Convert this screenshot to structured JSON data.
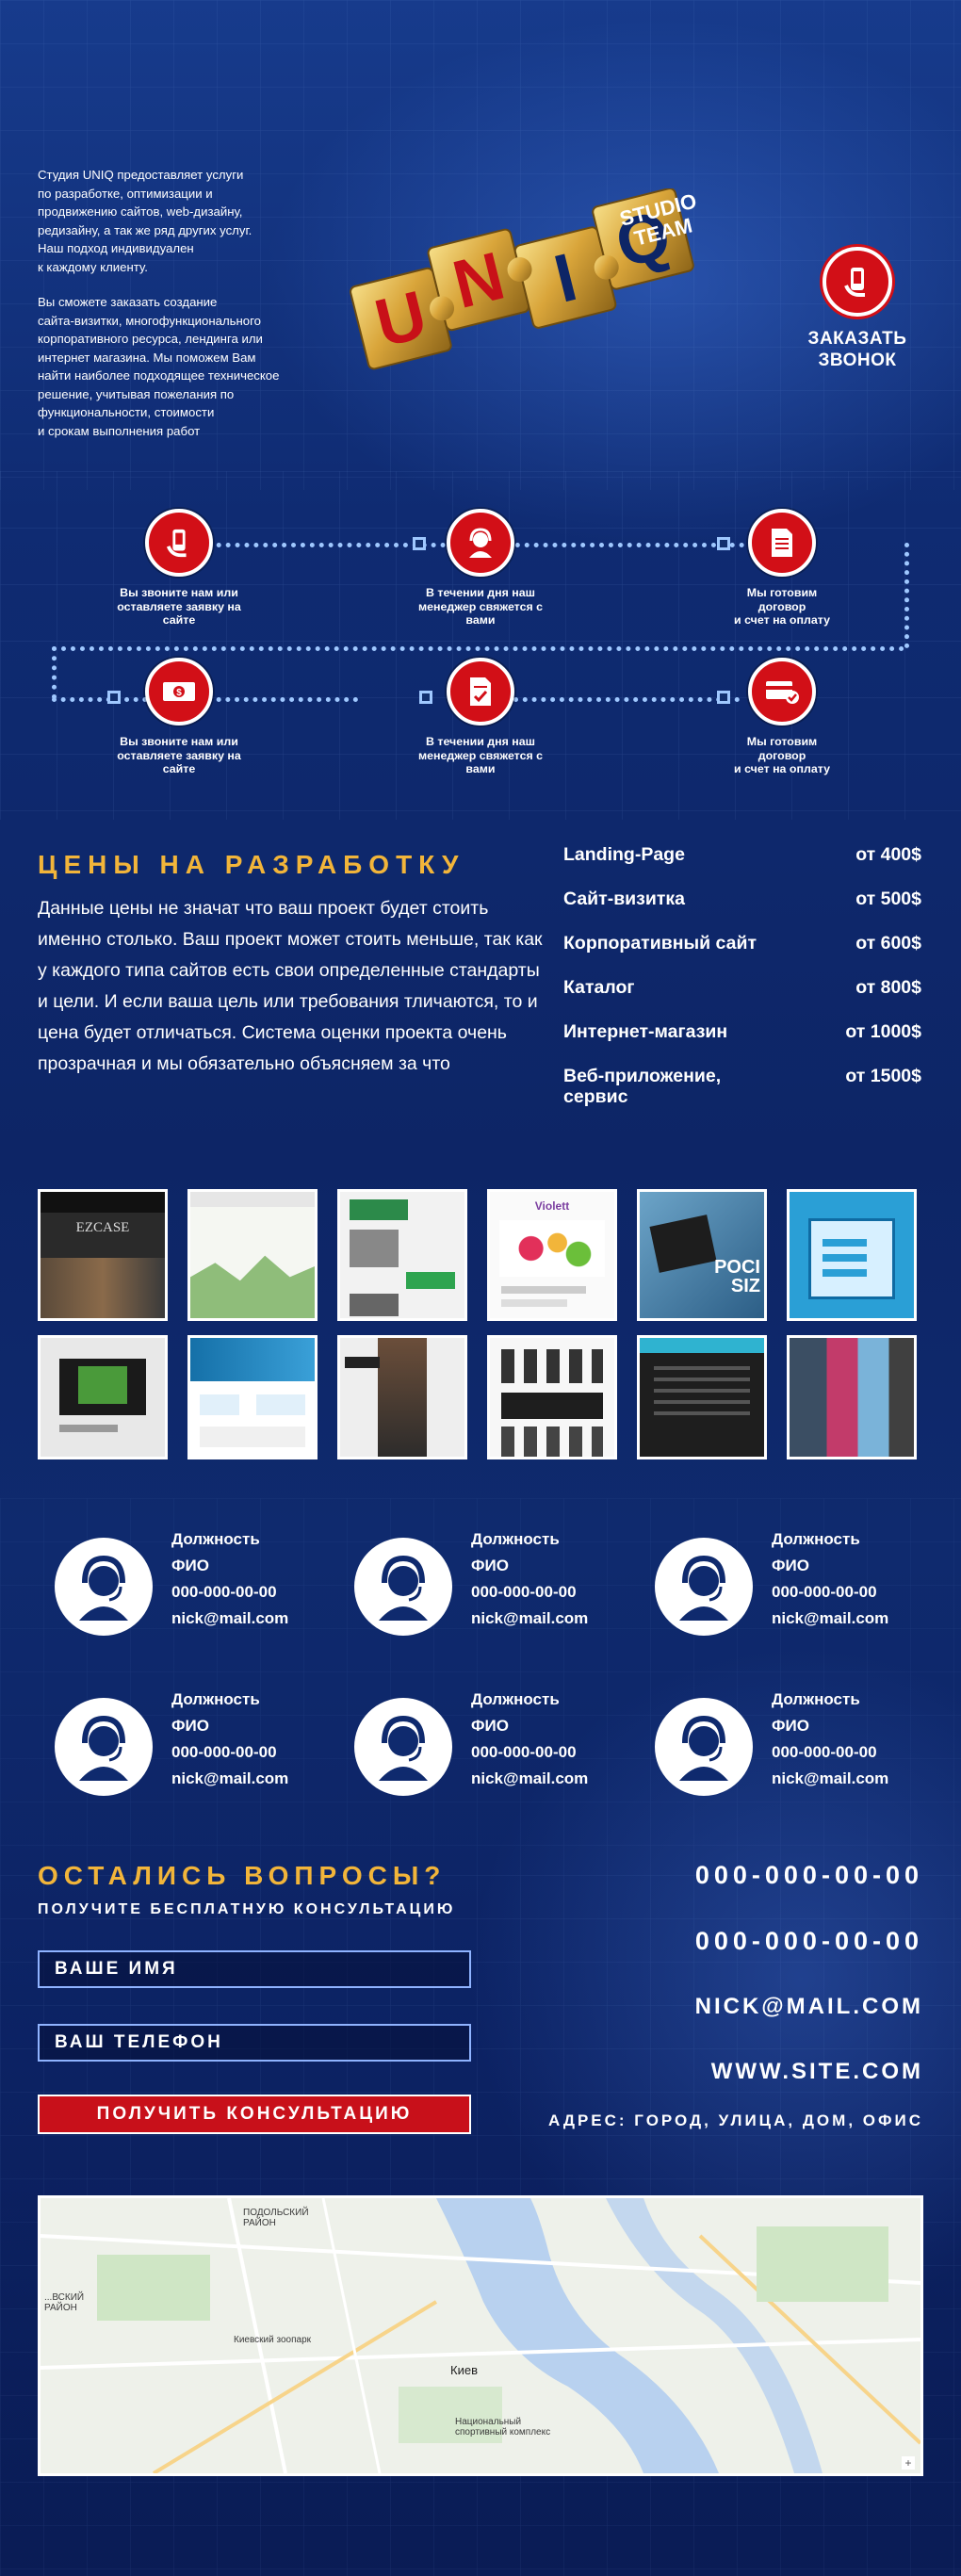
{
  "header": {
    "intro_p1": "Студия UNIQ предоставляет услуги\nпо разработке, оптимизации и\nпродвижению сайтов, web-дизайну,\nредизайну, а так же ряд других услуг.\nНаш подход индивидуален\nк каждому клиенту.",
    "intro_p2": "Вы сможете заказать создание\nсайта-визитки, многофункционального\nкорпоративного ресурса, лендинга или\nинтернет магазина. Мы поможем Вам\nнайти наиболее подходящее техническое\nрешение, учитывая пожелания по\nфункциональности, стоимости\nи срокам выполнения работ",
    "logo_letters": [
      "U",
      "N",
      "I",
      "Q"
    ],
    "logo_subtitle": "STUDIO\nTEAM",
    "call_label_1": "ЗАКАЗАТЬ",
    "call_label_2": "ЗВОНОК"
  },
  "steps": [
    {
      "label": "Вы звоните нам или\nоставляете заявку на\nсайте",
      "icon": "phone-hand-icon"
    },
    {
      "label": "В течении дня наш\nменеджер свяжется с\nвами",
      "icon": "operator-icon"
    },
    {
      "label": "Мы готовим\nдоговор\nи счет на оплату",
      "icon": "document-icon"
    },
    {
      "label": "Вы звоните нам или\nоставляете заявку на\nсайте",
      "icon": "money-icon"
    },
    {
      "label": "В течении дня наш\nменеджер свяжется с\nвами",
      "icon": "contract-check-icon"
    },
    {
      "label": "Мы готовим\nдоговор\nи счет на оплату",
      "icon": "card-check-icon"
    }
  ],
  "pricing": {
    "title": "ЦЕНЫ НА РАЗРАБОТКУ",
    "description": "Данные цены не значат что ваш проект будет стоить именно столько. Ваш проект может стоить меньше, так как у каждого типа сайтов есть свои определенные стандарты и цели. И если ваша цель или требования тличаются, то и цена будет отличаться. Система оценки проекта очень прозрачная и мы обязательно объясняем за что",
    "items": [
      {
        "name": "Landing-Page",
        "price": "от 400$"
      },
      {
        "name": "Сайт-визитка",
        "price": "от 500$"
      },
      {
        "name": "Корпоративный сайт",
        "price": "от 600$"
      },
      {
        "name": "Каталог",
        "price": "от 800$"
      },
      {
        "name": "Интернет-магазин",
        "price": "от 1000$"
      },
      {
        "name": "Веб-приложение, сервис",
        "price": "от 1500$"
      }
    ]
  },
  "portfolio": {
    "thumb_texts": [
      "EZCASE",
      "",
      "",
      "Violett",
      "POCI SIZ",
      "",
      "",
      "",
      "",
      "",
      "",
      ""
    ],
    "colors": [
      "#2a2a2a",
      "#e8f1e8",
      "#f2f2f2",
      "#fafafa",
      "#3c6fa3",
      "#1e6fb5",
      "#f4f4f4",
      "#2c7fb0",
      "#ececec",
      "#f7f7f7",
      "#1e1e1e",
      "#e1e1e1"
    ]
  },
  "team": [
    {
      "role": "Должность",
      "name": "ФИО",
      "phone": "000-000-00-00",
      "email": "nick@mail.com"
    },
    {
      "role": "Должность",
      "name": "ФИО",
      "phone": "000-000-00-00",
      "email": "nick@mail.com"
    },
    {
      "role": "Должность",
      "name": "ФИО",
      "phone": "000-000-00-00",
      "email": "nick@mail.com"
    },
    {
      "role": "Должность",
      "name": "ФИО",
      "phone": "000-000-00-00",
      "email": "nick@mail.com"
    },
    {
      "role": "Должность",
      "name": "ФИО",
      "phone": "000-000-00-00",
      "email": "nick@mail.com"
    },
    {
      "role": "Должность",
      "name": "ФИО",
      "phone": "000-000-00-00",
      "email": "nick@mail.com"
    }
  ],
  "contact": {
    "title": "ОСТАЛИСЬ ВОПРОСЫ?",
    "subtitle": "ПОЛУЧИТЕ БЕСПЛАТНУЮ КОНСУЛЬТАЦИЮ",
    "name_placeholder": "ВАШЕ ИМЯ",
    "phone_placeholder": "ВАШ ТЕЛЕФОН",
    "submit_label": "ПОЛУЧИТЬ КОНСУЛЬТАЦИЮ",
    "phone1": "000-000-00-00",
    "phone2": "000-000-00-00",
    "email": "NICK@MAIL.COM",
    "site": "WWW.SITE.COM",
    "address": "АДРЕС: ГОРОД, УЛИЦА, ДОМ, ОФИС"
  },
  "map": {
    "district_label": "ПОДОЛЬСКИЙ\nРАЙОН",
    "left_label": "...ВСКИЙ\nРАЙОН",
    "city_label": "Киев",
    "place1": "Киевский зоопарк",
    "place2": "Национальный\nспортивный комплекс",
    "accent": "#b8d1ef"
  },
  "colors": {
    "accent_red": "#d20f17",
    "accent_gold": "#f2b53a",
    "background": "#0f2a6e"
  }
}
